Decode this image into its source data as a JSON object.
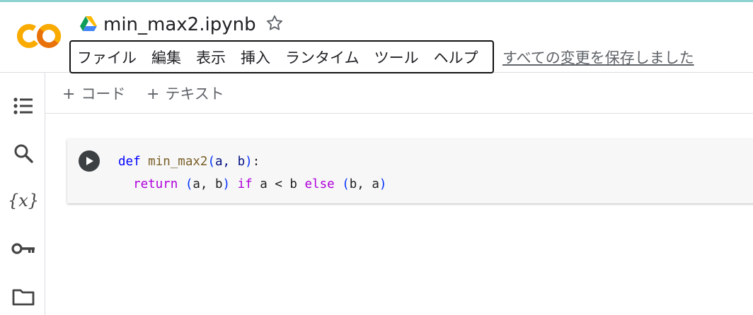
{
  "app": {
    "notebook_title": "min_max2.ipynb",
    "saved_status": "すべての変更を保存しました"
  },
  "menu": {
    "items": [
      "ファイル",
      "編集",
      "表示",
      "挿入",
      "ランタイム",
      "ツール",
      "ヘルプ"
    ]
  },
  "toolbar": {
    "add_code_label": "コード",
    "add_text_label": "テキスト",
    "plus_glyph": "+"
  },
  "sidebar": {
    "variables_label": "{x}",
    "icons": [
      "table-of-contents-icon",
      "search-icon",
      "variables-icon",
      "key-icon",
      "folder-icon"
    ]
  },
  "cell": {
    "line1": {
      "def": "def",
      "name": "min_max2",
      "open": "(",
      "params": "a, b",
      "close": ")",
      "colon": ":"
    },
    "line2": {
      "indent": "  ",
      "return": "return",
      "open1": "(",
      "tuple1": "a, b",
      "close1": ")",
      "if": "if",
      "cond": "a < b",
      "else": "else",
      "open2": "(",
      "tuple2": "b, a",
      "close2": ")"
    }
  },
  "colors": {
    "logo_orange": "#f9ab00",
    "logo_dark_orange": "#e8710a",
    "keyword_blue": "#0000ff",
    "keyword_purple": "#af00db",
    "function_brown": "#795e26",
    "link_gray": "#5f6368"
  }
}
